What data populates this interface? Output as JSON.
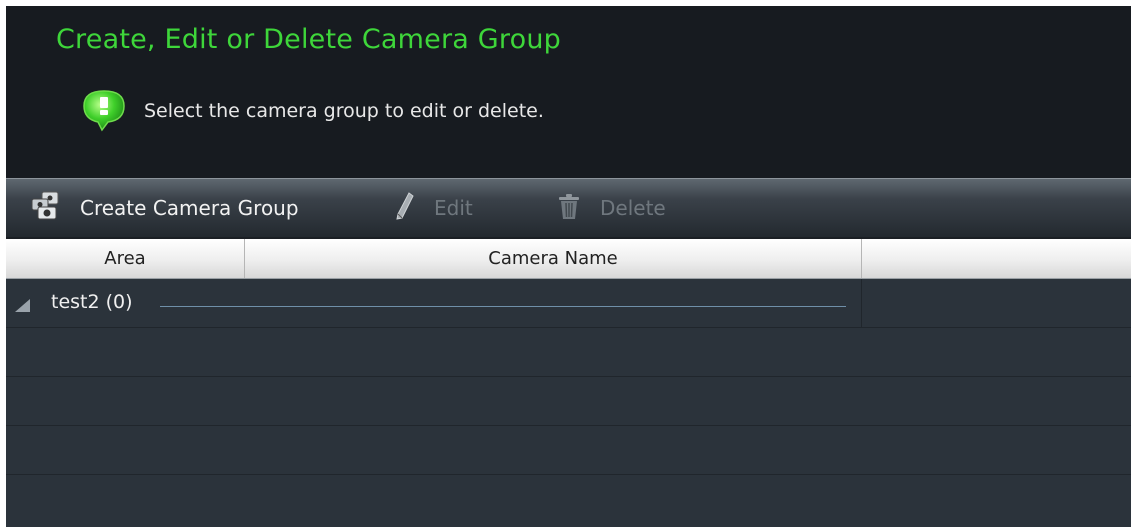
{
  "header": {
    "title": "Create, Edit or Delete Camera Group",
    "hint": "Select the camera group to edit or delete.",
    "hint_icon": "info-bubble-icon",
    "title_color": "#3ed63a"
  },
  "toolbar": {
    "create_label": "Create Camera Group",
    "create_icon": "camera-group-icon",
    "edit_label": "Edit",
    "edit_icon": "pencil-icon",
    "delete_label": "Delete",
    "delete_icon": "trash-icon"
  },
  "table": {
    "columns": [
      "Area",
      "Camera Name",
      ""
    ],
    "groups": [
      {
        "label": "test2 (0)",
        "expanded": true
      }
    ]
  }
}
